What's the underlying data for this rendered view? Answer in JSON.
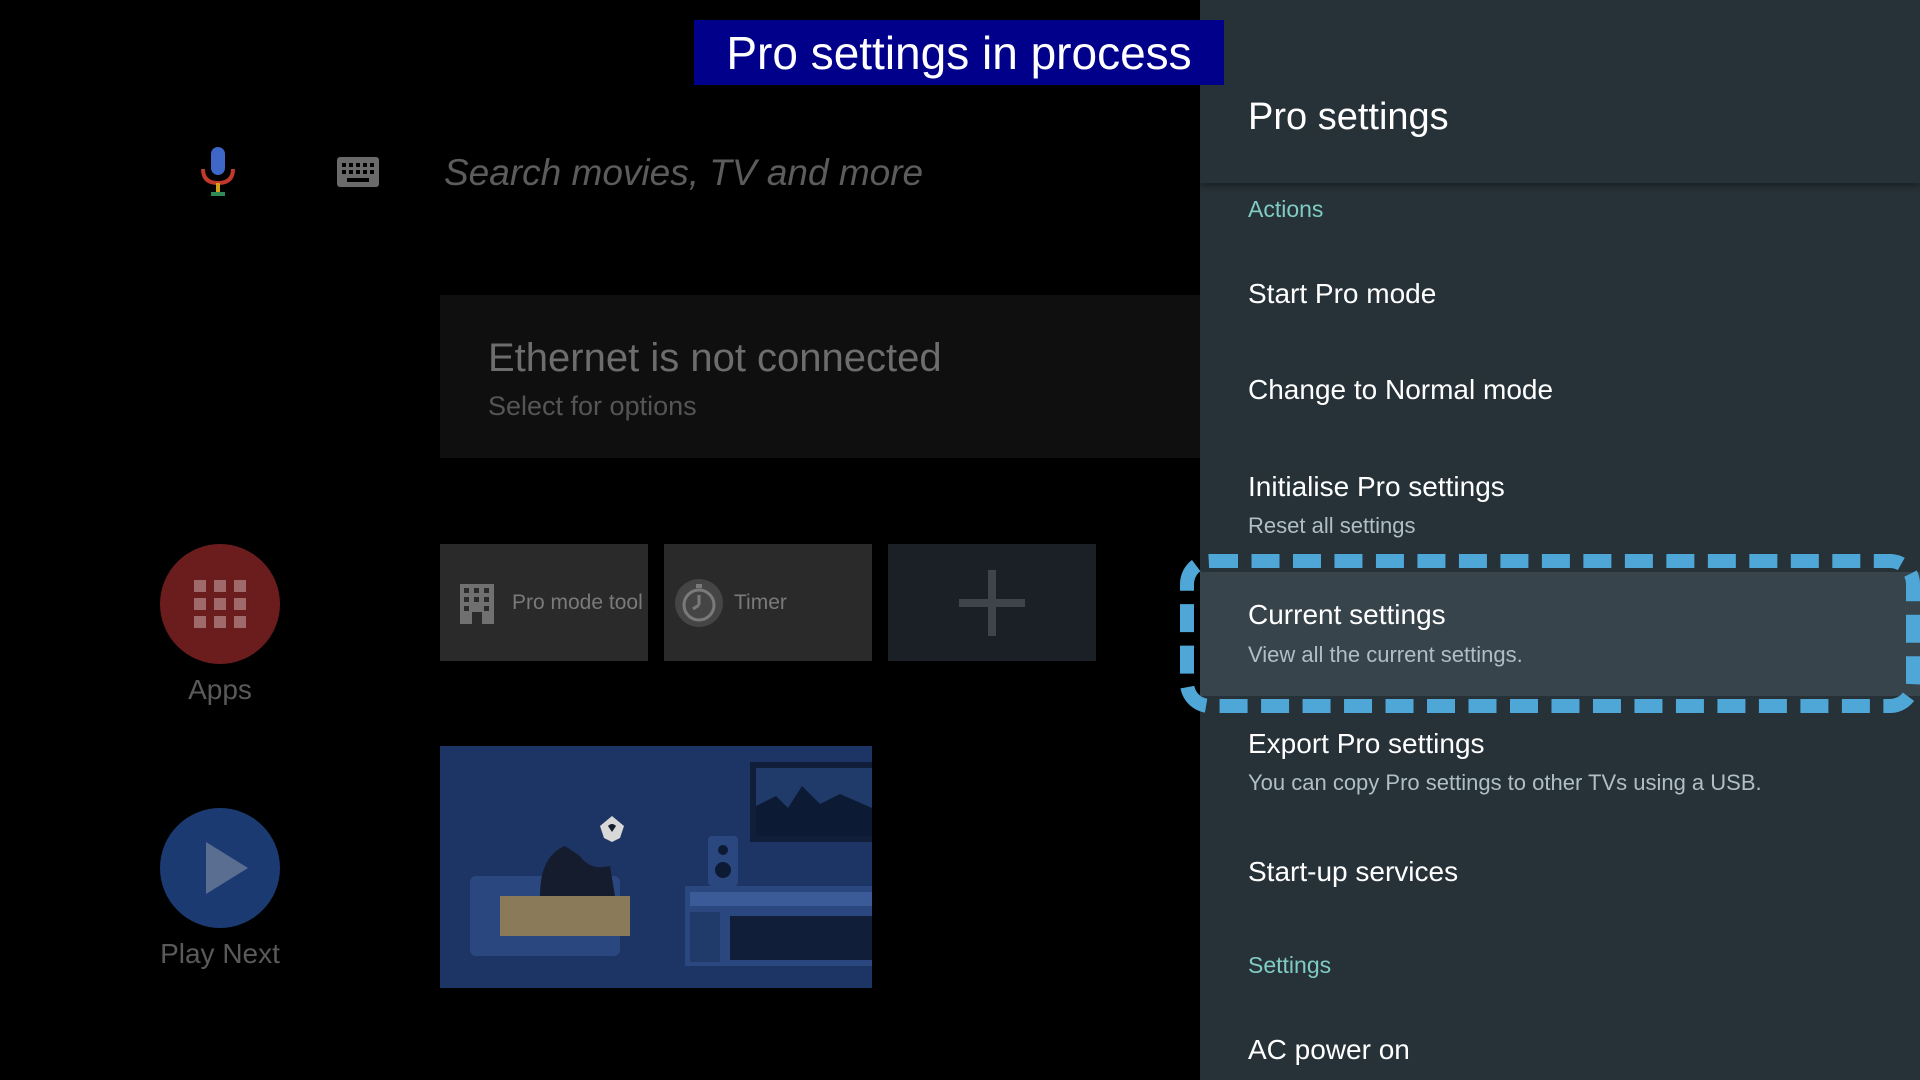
{
  "overlay": {
    "banner_text": "Pro settings in process"
  },
  "home": {
    "search_placeholder": "Search movies, TV and more",
    "network_card": {
      "title": "Ethernet is not connected",
      "subtitle": "Select for options"
    },
    "side_nav": [
      {
        "label": "Apps",
        "icon": "apps-grid-icon",
        "color": "#6b1d1d"
      },
      {
        "label": "Play Next",
        "icon": "play-icon",
        "color": "#1b3a72"
      }
    ],
    "app_tiles": [
      {
        "label": "Pro mode tool",
        "icon": "building-icon"
      },
      {
        "label": "Timer",
        "icon": "timer-icon"
      },
      {
        "label": "",
        "icon": "plus-icon"
      }
    ]
  },
  "panel": {
    "title": "Pro settings",
    "sections": [
      {
        "label": "Actions"
      },
      {
        "label": "Settings"
      }
    ],
    "items": [
      {
        "title": "Start Pro mode",
        "subtitle": ""
      },
      {
        "title": "Change to Normal mode",
        "subtitle": ""
      },
      {
        "title": "Initialise Pro settings",
        "subtitle": "Reset all settings"
      },
      {
        "title": "Current settings",
        "subtitle": "View all the current settings.",
        "focused": true
      },
      {
        "title": "Export Pro settings",
        "subtitle": "You can copy Pro settings to other TVs using a USB."
      },
      {
        "title": "Start-up services",
        "subtitle": ""
      },
      {
        "title": "AC power on",
        "subtitle": ""
      }
    ]
  },
  "colors": {
    "panel_bg": "#263238",
    "section_accent": "#80cbc4",
    "focus_frame": "#4fa7d8",
    "banner_bg": "#00008b"
  }
}
